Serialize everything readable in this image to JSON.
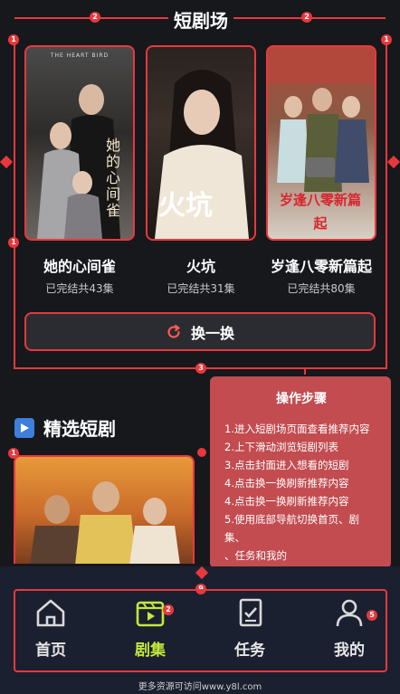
{
  "header": {
    "title": "短剧场",
    "annotations": [
      "2",
      "2"
    ]
  },
  "shelf": {
    "items": [
      {
        "title": "她的心间雀",
        "status": "已完结共43集",
        "poster_text": "她的心间雀",
        "poster_caption": "THE HEART BIRD"
      },
      {
        "title": "火坑",
        "status": "已完结共31集",
        "poster_text": "火坑",
        "poster_caption": ""
      },
      {
        "title": "岁逢八零新篇起",
        "status": "已完结共80集",
        "poster_text": "岁逢八零新篇起",
        "poster_caption": ""
      }
    ],
    "refresh_label": "换一换",
    "annotations": {
      "left_top": "1",
      "right_top": "1",
      "left_mid": "1",
      "bottom": "3"
    }
  },
  "featured": {
    "title": "精选短剧",
    "annotation": "1"
  },
  "steps_panel": {
    "title": "操作步骤",
    "steps": [
      "1.进入短剧场页面查看推荐内容",
      "2.上下滑动浏览短剧列表",
      "3.点击封面进入想看的短剧",
      "4.点击换一换刷新推荐内容",
      "4.点击换一换刷新推荐内容",
      "5.使用底部导航切换首页、剧集、",
      "、任务和我的"
    ]
  },
  "bottom_nav": {
    "items": [
      {
        "label": "首页",
        "icon": "home-icon",
        "active": false,
        "badge": ""
      },
      {
        "label": "剧集",
        "icon": "play-icon",
        "active": true,
        "badge": "2"
      },
      {
        "label": "任务",
        "icon": "task-icon",
        "active": false,
        "badge": ""
      },
      {
        "label": "我的",
        "icon": "user-icon",
        "active": false,
        "badge": "5"
      }
    ],
    "annotation": "9"
  },
  "footer": {
    "text": "更多资源可访问www.y8l.com"
  },
  "colors": {
    "accent": "#e8383d",
    "active_tab": "#c5e83a",
    "background": "#16181c",
    "panel": "#e8585c"
  }
}
